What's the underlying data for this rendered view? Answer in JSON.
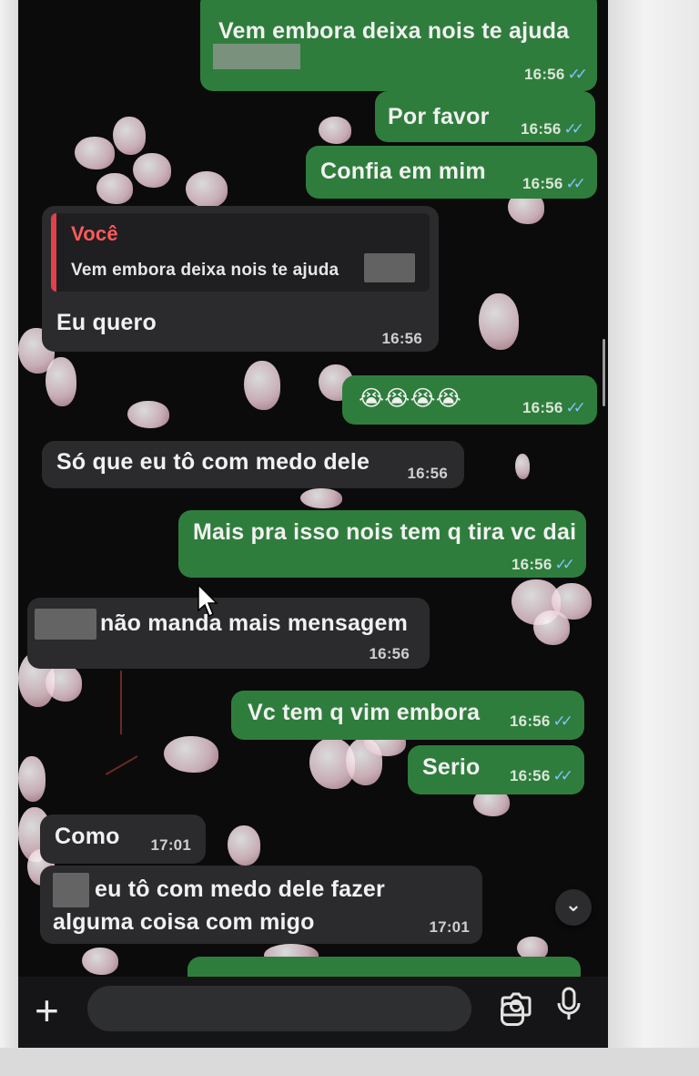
{
  "conversation": {
    "messages": [
      {
        "id": "m1",
        "direction": "out",
        "text": "Vem embora deixa nois te ajuda",
        "time": "16:56",
        "status": "read"
      },
      {
        "id": "m2",
        "direction": "out",
        "text": "Por favor",
        "time": "16:56",
        "status": "read"
      },
      {
        "id": "m3",
        "direction": "out",
        "text": "Confia em mim",
        "time": "16:56",
        "status": "read"
      },
      {
        "id": "m4",
        "direction": "in",
        "quote_author": "Você",
        "quote_text": "Vem embora deixa nois te ajuda",
        "text": "Eu quero",
        "time": "16:56"
      },
      {
        "id": "m5",
        "direction": "out",
        "text": "😭😭😭😭",
        "time": "16:56",
        "status": "read"
      },
      {
        "id": "m6",
        "direction": "in",
        "text": "Só que eu tô com medo dele",
        "time": "16:56"
      },
      {
        "id": "m7",
        "direction": "out",
        "text": "Mais pra isso nois tem q tira vc dai",
        "time": "16:56",
        "status": "read"
      },
      {
        "id": "m8",
        "direction": "in",
        "text": "não manda mais mensagem",
        "time": "16:56"
      },
      {
        "id": "m9",
        "direction": "out",
        "text": "Vc tem q vim embora",
        "time": "16:56",
        "status": "read"
      },
      {
        "id": "m10",
        "direction": "out",
        "text": "Serio",
        "time": "16:56",
        "status": "read"
      },
      {
        "id": "m11",
        "direction": "in",
        "text": "Como",
        "time": "17:01"
      },
      {
        "id": "m12",
        "direction": "in",
        "text_line1": "eu tô com medo dele fazer",
        "text_line2": "alguma coisa com migo",
        "time": "17:01"
      }
    ]
  },
  "read_receipt_icon": "double-check-blue",
  "composer": {
    "attach_icon": "plus-icon",
    "sticker_icon": "sticker-icon",
    "camera_icon": "camera-icon",
    "mic_icon": "microphone-icon"
  },
  "scroll_down_icon": "chevron-down-icon",
  "colors": {
    "outgoing_bubble": "#2f7d3c",
    "incoming_bubble": "#2b2b2e",
    "quote_accent": "#e0414a",
    "read_check": "#7fc4ff",
    "background": "#0b0b0c"
  }
}
